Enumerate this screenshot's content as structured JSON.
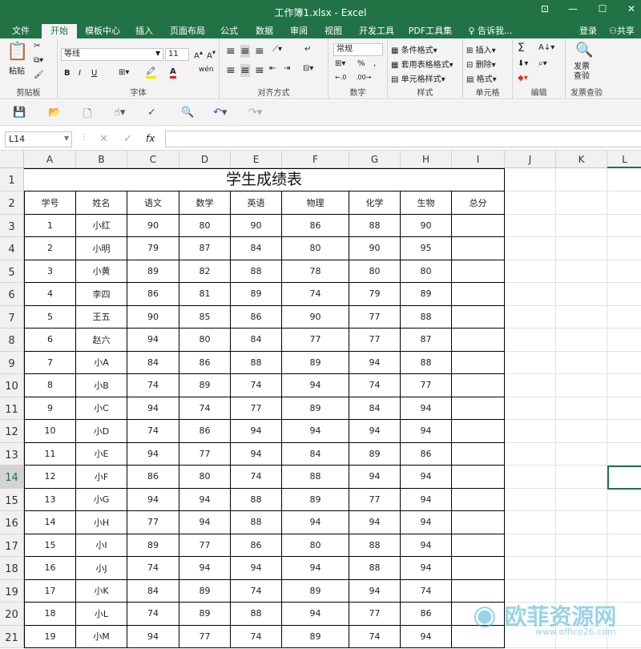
{
  "window": {
    "title": "工作簿1.xlsx - Excel",
    "controls": [
      "⊡",
      "—",
      "☐",
      "✕"
    ]
  },
  "tabs": [
    "文件",
    "开始",
    "模板中心",
    "插入",
    "页面布局",
    "公式",
    "数据",
    "审阅",
    "视图",
    "开发工具",
    "PDF工具集"
  ],
  "tell_me": "告诉我...",
  "login": "登录",
  "share": "共享",
  "ribbon": {
    "clipboard": {
      "label": "剪贴板",
      "paste": "粘贴"
    },
    "font": {
      "label": "字体",
      "name": "等线",
      "size": "11",
      "bold": "B",
      "italic": "I",
      "underline": "U",
      "phonetic": "wén"
    },
    "align": {
      "label": "对齐方式"
    },
    "number": {
      "label": "数字",
      "format": "常规",
      "percent": "%"
    },
    "styles": {
      "label": "样式",
      "cond": "条件格式",
      "table": "套用表格格式",
      "cell": "单元格样式"
    },
    "cells": {
      "label": "单元格",
      "insert": "插入",
      "delete": "删除",
      "format": "格式"
    },
    "edit": {
      "label": "编辑",
      "sum": "Σ"
    },
    "invoice": {
      "label": "发票查验",
      "btn": "发票\n查验"
    }
  },
  "formula": {
    "namebox": "L14",
    "cancel": "✕",
    "enter": "✓",
    "fx": "fx",
    "value": ""
  },
  "columns": [
    "A",
    "B",
    "C",
    "D",
    "E",
    "F",
    "G",
    "H",
    "I",
    "J",
    "K",
    "L"
  ],
  "sheet": {
    "title": "学生成绩表",
    "headers": [
      "学号",
      "姓名",
      "语文",
      "数学",
      "英语",
      "物理",
      "化学",
      "生物",
      "总分"
    ],
    "rows": [
      [
        "1",
        "小红",
        "90",
        "80",
        "90",
        "86",
        "88",
        "90",
        ""
      ],
      [
        "2",
        "小明",
        "79",
        "87",
        "84",
        "80",
        "90",
        "95",
        ""
      ],
      [
        "3",
        "小黄",
        "89",
        "82",
        "88",
        "78",
        "80",
        "80",
        ""
      ],
      [
        "4",
        "李四",
        "86",
        "81",
        "89",
        "74",
        "79",
        "89",
        ""
      ],
      [
        "5",
        "王五",
        "90",
        "85",
        "86",
        "90",
        "77",
        "88",
        ""
      ],
      [
        "6",
        "赵六",
        "94",
        "80",
        "84",
        "77",
        "77",
        "87",
        ""
      ],
      [
        "7",
        "小A",
        "84",
        "86",
        "88",
        "89",
        "94",
        "88",
        ""
      ],
      [
        "8",
        "小B",
        "74",
        "89",
        "74",
        "94",
        "74",
        "77",
        ""
      ],
      [
        "9",
        "小C",
        "94",
        "74",
        "77",
        "89",
        "84",
        "94",
        ""
      ],
      [
        "10",
        "小D",
        "74",
        "86",
        "94",
        "94",
        "94",
        "94",
        ""
      ],
      [
        "11",
        "小E",
        "94",
        "77",
        "94",
        "84",
        "89",
        "86",
        ""
      ],
      [
        "12",
        "小F",
        "86",
        "80",
        "74",
        "88",
        "94",
        "94",
        ""
      ],
      [
        "13",
        "小G",
        "94",
        "94",
        "88",
        "89",
        "77",
        "94",
        ""
      ],
      [
        "14",
        "小H",
        "77",
        "94",
        "88",
        "94",
        "94",
        "94",
        ""
      ],
      [
        "15",
        "小I",
        "89",
        "77",
        "86",
        "80",
        "88",
        "94",
        ""
      ],
      [
        "16",
        "小J",
        "74",
        "94",
        "94",
        "94",
        "88",
        "94",
        ""
      ],
      [
        "17",
        "小K",
        "84",
        "89",
        "74",
        "89",
        "94",
        "74",
        ""
      ],
      [
        "18",
        "小L",
        "74",
        "89",
        "88",
        "94",
        "77",
        "86",
        ""
      ],
      [
        "19",
        "小M",
        "94",
        "77",
        "74",
        "89",
        "74",
        "94",
        ""
      ]
    ]
  },
  "watermark": {
    "text": "欧菲资源网",
    "sub": "www.office26.com"
  }
}
